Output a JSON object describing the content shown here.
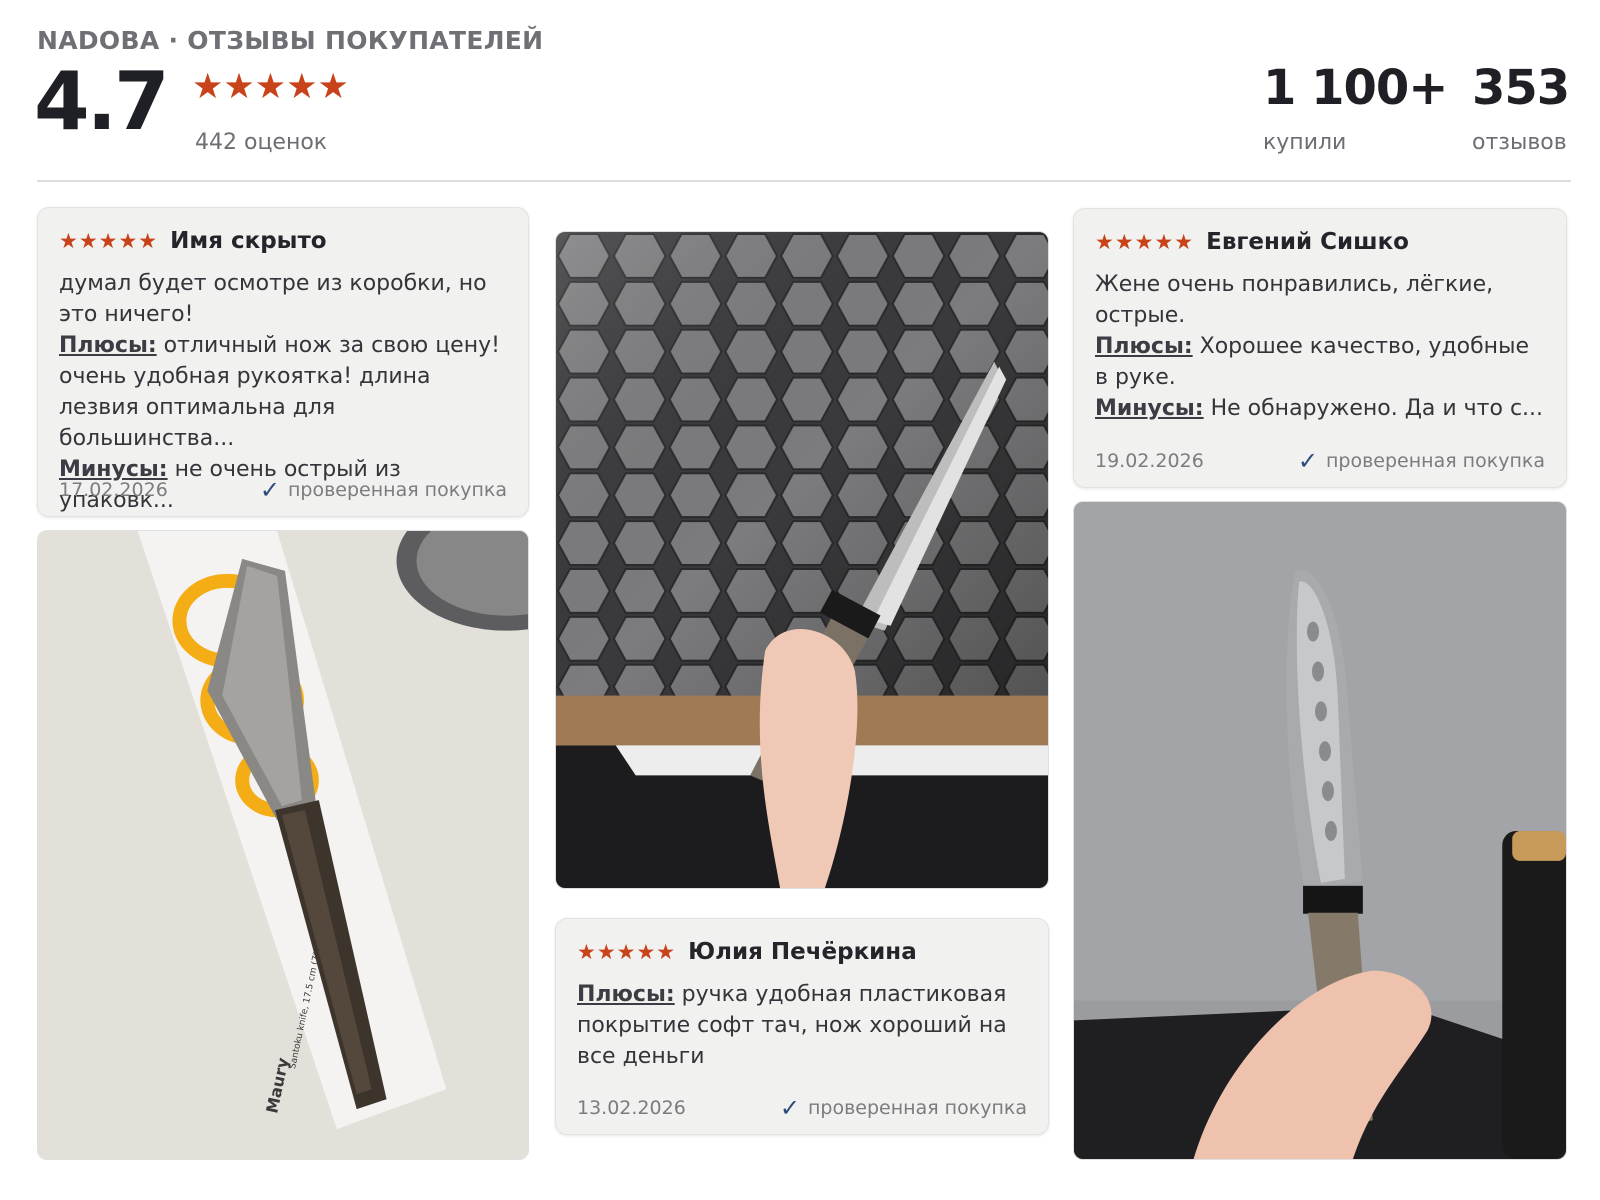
{
  "header": {
    "brand": "NADOBA · ОТЗЫВЫ ПОКУПАТЕЛЕЙ",
    "rating": "4.7",
    "stars": "★★★★★",
    "ratings_count": "442 оценок",
    "bought_value": "1 100+",
    "bought_label": "купили",
    "reviews_value": "353",
    "reviews_label": "отзывов"
  },
  "reviews": [
    {
      "stars": "★★★★★",
      "author": "Имя скрыто",
      "text": "думал будет осмотре из коробки, но это ничего!",
      "pros_label": "Плюсы:",
      "pros": " отличный нож за свою цену! очень удобная рукоятка! длина лезвия оптимальна для большинства...",
      "cons_label": "Минусы:",
      "cons": " не очень острый из упаковк...",
      "date": "17.02.2026",
      "verified": "проверенная покупка"
    },
    {
      "stars": "★★★★★",
      "author": "Юлия Печёркина",
      "pros_label": "Плюсы:",
      "pros": " ручка удобная пластиковая покрытие софт тач, нож хороший на все деньги",
      "date": "13.02.2026",
      "verified": "проверенная покупка"
    },
    {
      "stars": "★★★★★",
      "author": "Евгений Сишко",
      "text": "Жене очень понравились, лёгкие, острые.",
      "pros_label": "Плюсы:",
      "pros": " Хорошее качество, удобные в руке.",
      "cons_label": "Минусы:",
      "cons": " Не обнаружено. Да и что с...",
      "date": "19.02.2026",
      "verified": "проверенная покупка"
    }
  ],
  "photos": {
    "box_label_brand": "Maury",
    "box_label_text": "Santoku knife, 17.5 cm (7\")"
  },
  "icons": {
    "star": "star-icon",
    "check": "checkmark-icon"
  },
  "colors": {
    "star": "#c8421a",
    "check": "#2c4b7c",
    "card_bg": "#f1f1ef"
  }
}
